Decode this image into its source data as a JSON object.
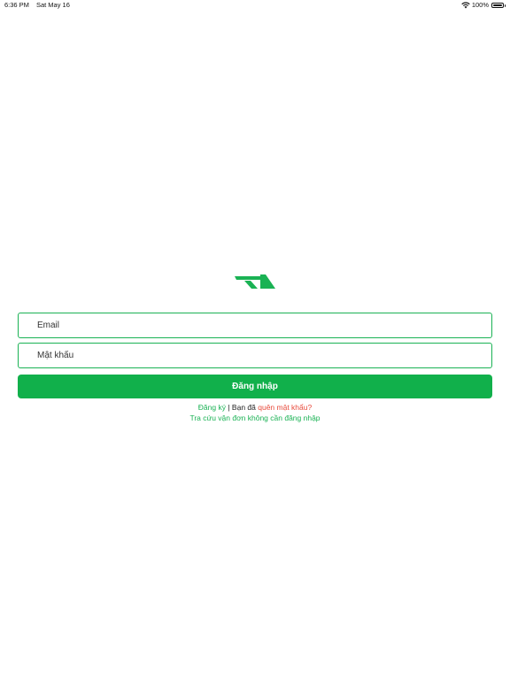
{
  "status_bar": {
    "time": "6:36 PM",
    "date": "Sat May 16",
    "battery": "100%"
  },
  "colors": {
    "brand_green": "#11b04b",
    "field_border": "#1ab254",
    "link_red": "#e84b3c"
  },
  "form": {
    "email_placeholder": "Email",
    "email_value": "",
    "password_placeholder": "Mật khẩu",
    "password_value": "",
    "login_label": "Đăng nhập"
  },
  "links": {
    "register": "Đăng ký",
    "separator": " | ",
    "forgot_prefix": "Bạn đã ",
    "forgot": "quên mật khẩu?",
    "track_without_login": "Tra cứu vận đơn không cần đăng nhập"
  },
  "icons": {
    "logo": "brand-logo-icon",
    "wifi": "wifi-icon",
    "battery": "battery-icon"
  }
}
